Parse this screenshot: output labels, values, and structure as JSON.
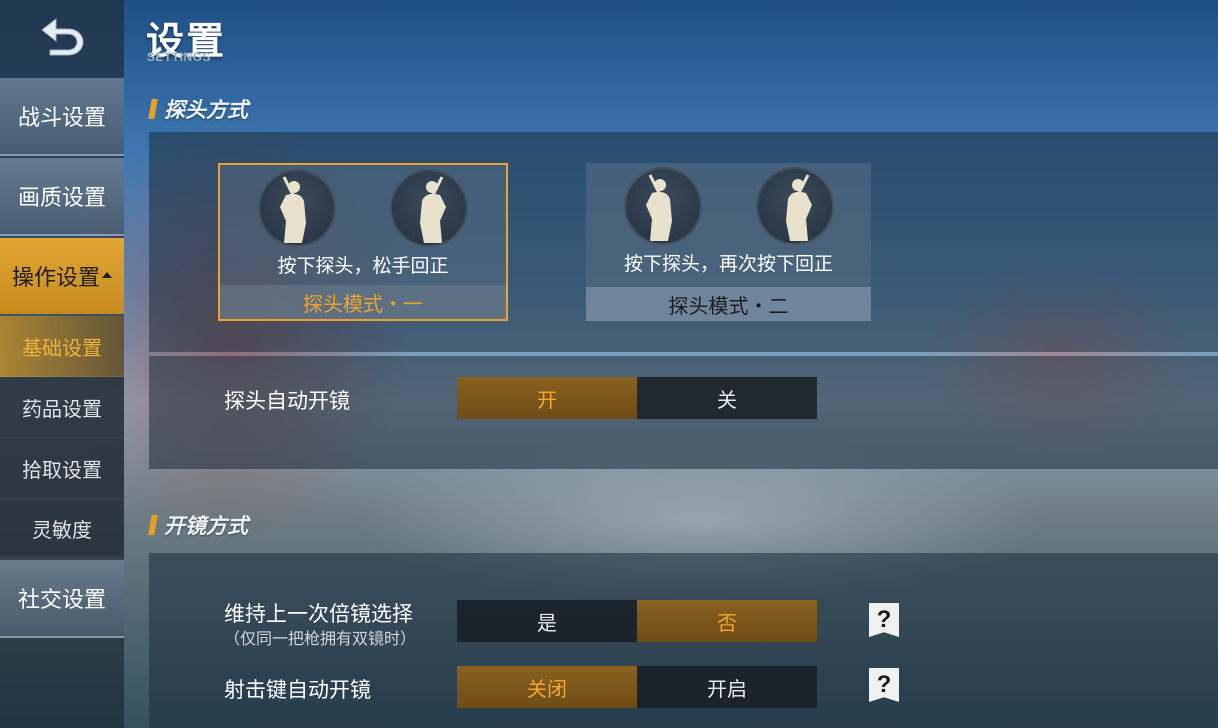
{
  "header": {
    "title": "设置",
    "subtitle": "SETTINGS"
  },
  "sidebar": {
    "back_icon": "back-arrow-icon",
    "items": [
      {
        "label": "战斗设置"
      },
      {
        "label": "画质设置"
      },
      {
        "label": "操作设置"
      },
      {
        "label": "基础设置"
      },
      {
        "label": "药品设置"
      },
      {
        "label": "拾取设置"
      },
      {
        "label": "灵敏度"
      },
      {
        "label": "社交设置"
      }
    ]
  },
  "peek_section": {
    "title": "探头方式",
    "modes": [
      {
        "desc": "按下探头，松手回正",
        "label": "探头模式・一",
        "selected": true
      },
      {
        "desc": "按下探头，再次按下回正",
        "label": "探头模式・二",
        "selected": false
      }
    ],
    "auto_scope": {
      "label": "探头自动开镜",
      "options": [
        "开",
        "关"
      ],
      "selected": "开"
    }
  },
  "scope_section": {
    "title": "开镜方式",
    "keep_zoom": {
      "label": "维持上一次倍镜选择",
      "note": "（仅同一把枪拥有双镜时）",
      "options": [
        "是",
        "否"
      ],
      "selected": "否"
    },
    "fire_auto_scope": {
      "label": "射击键自动开镜",
      "options": [
        "关闭",
        "开启"
      ],
      "selected": "关闭"
    },
    "help_symbol": "?"
  },
  "colors": {
    "accent": "#eba32e",
    "panel": "#1e2d3c"
  }
}
